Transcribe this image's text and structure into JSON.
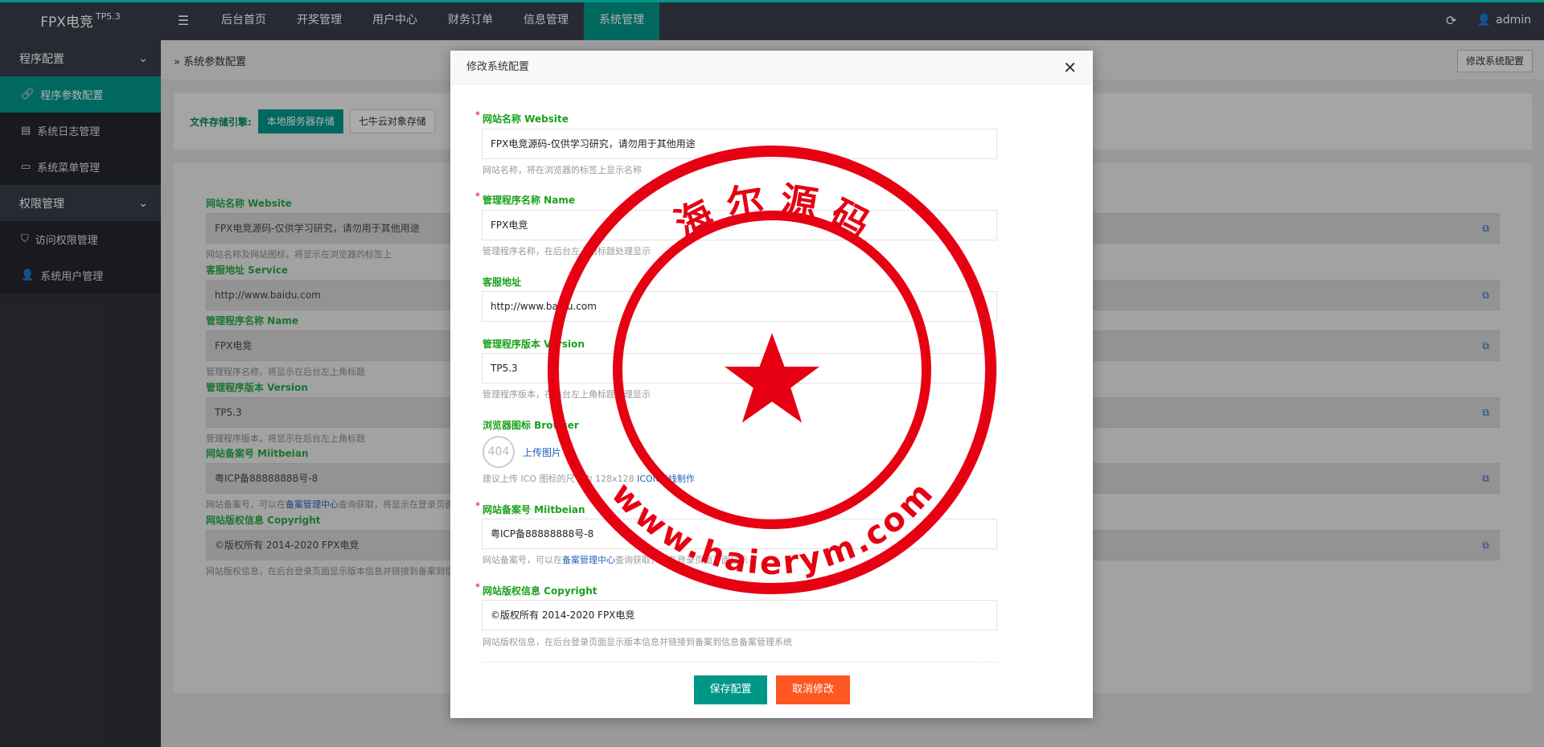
{
  "brand": {
    "name": "FPX电竞",
    "version": "TP5.3"
  },
  "top_nav": [
    {
      "label": "后台首页"
    },
    {
      "label": "开奖管理"
    },
    {
      "label": "用户中心"
    },
    {
      "label": "财务订单"
    },
    {
      "label": "信息管理"
    },
    {
      "label": "系统管理"
    }
  ],
  "top_right": {
    "user": "admin"
  },
  "sidebar": {
    "group1": "程序配置",
    "items1": [
      "程序参数配置",
      "系统日志管理",
      "系统菜单管理"
    ],
    "group2": "权限管理",
    "items2": [
      "访问权限管理",
      "系统用户管理"
    ]
  },
  "breadcrumb": "系统参数配置",
  "modify_button": "修改系统配置",
  "storage": {
    "label": "文件存储引擎:",
    "options": [
      "本地服务器存储",
      "七牛云对象存储"
    ]
  },
  "form": {
    "site_name_label": "网站名称 Website",
    "site_name_value": "FPX电竞源码-仅供学习研究，请勿用于其他用途",
    "site_name_help": "网站名称及网站图标，将显示在浏览器的标签上",
    "service_label": "客服地址 Service",
    "service_value": "http://www.baidu.com",
    "app_name_label": "管理程序名称 Name",
    "app_name_value": "FPX电竞",
    "app_name_help": "管理程序名称，将显示在后台左上角标题",
    "version_label": "管理程序版本 Version",
    "version_value": "TP5.3",
    "version_help": "管理程序版本，将显示在后台左上角标题",
    "beian_label": "网站备案号 Miitbeian",
    "beian_value": "粤ICP备88888888号-8",
    "beian_help_pre": "网站备案号，可以在",
    "beian_help_link": "备案管理中心",
    "beian_help_post": "查询获取，将显示在登录页面下面",
    "copyright_label": "网站版权信息 Copyright",
    "copyright_value": "©版权所有 2014-2020 FPX电竞",
    "copyright_help": "网站版权信息，在后台登录页面显示版本信息并链接到备案到信息备案管理系统"
  },
  "modal": {
    "title": "修改系统配置",
    "site_name_label": "网站名称 Website",
    "site_name_value": "FPX电竞源码-仅供学习研究，请勿用于其他用途",
    "site_name_help": "网站名称，将在浏览器的标签上显示名称",
    "app_name_label": "管理程序名称 Name",
    "app_name_value": "FPX电竞",
    "app_name_help": "管理程序名称，在后台左上角标题处理显示",
    "service_label": "客服地址",
    "service_value": "http://www.baidu.com",
    "version_label": "管理程序版本 Version",
    "version_value": "TP5.3",
    "version_help": "管理程序版本，在后台左上角标题处理显示",
    "browser_label": "浏览器图标 Browser",
    "upload_thumb": "404",
    "upload_label": "上传图片",
    "browser_help_pre": "建议上传 ICO 图标的尺寸为 128x128 ",
    "browser_help_link": "ICON在线制作",
    "beian_label": "网站备案号 Miitbeian",
    "beian_value": "粤ICP备88888888号-8",
    "beian_help_pre": "网站备案号，可以在",
    "beian_help_link": "备案管理中心",
    "beian_help_post": "查询获取，将在登录页面下面显示",
    "copyright_label": "网站版权信息 Copyright",
    "copyright_value": "©版权所有 2014-2020 FPX电竞",
    "copyright_help": "网站版权信息，在后台登录页面显示版本信息并链接到备案到信息备案管理系统",
    "save_label": "保存配置",
    "cancel_label": "取消修改",
    "required_mark": "*"
  },
  "watermark": {
    "top_text": "海 尔 源 码",
    "bottom_text": "www.haierym.com",
    "color": "#e60012"
  },
  "colors": {
    "accent": "#009688",
    "danger": "#ff5722",
    "label_green": "#1aa11a"
  }
}
